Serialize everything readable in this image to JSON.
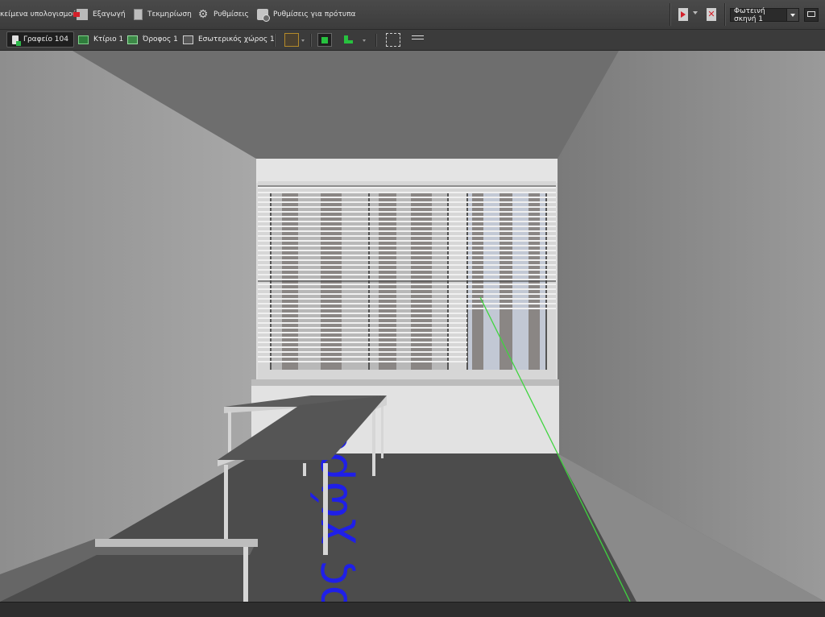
{
  "toolbar": {
    "calc_objects_label": "κείμενα υπολογισμού",
    "export_label": "Εξαγωγή",
    "documentation_label": "Τεκμηρίωση",
    "settings_label": "Ρυθμίσεις",
    "template_settings_label": "Ρυθμίσεις για πρότυπα",
    "light_scene": {
      "selected": "Φωτεινή σκηνή 1"
    }
  },
  "breadcrumb": {
    "items": [
      {
        "label": "Γραφείο 104",
        "icon": "room-icon",
        "active": true
      },
      {
        "label": "Κτίριο 1",
        "icon": "building-icon",
        "active": false
      },
      {
        "label": "Όροφος 1",
        "icon": "floor-icon",
        "active": false
      },
      {
        "label": "Εσωτερικός χώρος 1",
        "icon": "interior-space-icon",
        "active": false
      }
    ]
  },
  "viewport": {
    "floor_label": "ος χώρο",
    "colors": {
      "floor_label": "#1f1fe8",
      "guide_line": "#3fd43f"
    }
  }
}
